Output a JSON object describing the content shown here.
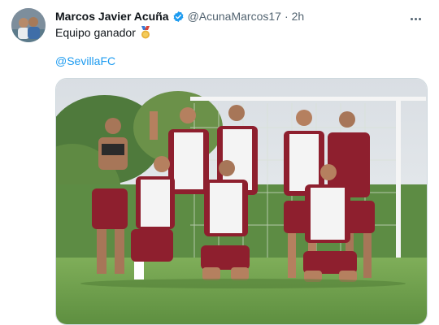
{
  "tweet": {
    "author_name": "Marcos Javier Acuña",
    "handle": "@AcunaMarcos17",
    "separator": "·",
    "time": "2h",
    "text": "Equipo ganador",
    "mention": "@SevillaFC",
    "icons": {
      "verified": "verified-badge-icon",
      "medal": "medal-icon",
      "more": "more-options-icon"
    }
  },
  "colors": {
    "link": "#1d9bf0",
    "verified": "#1d9bf0",
    "muted": "#536471",
    "grass": "#6f9e4e",
    "kit_red": "#8e1f2e",
    "bib_white": "#f4f4f4"
  }
}
